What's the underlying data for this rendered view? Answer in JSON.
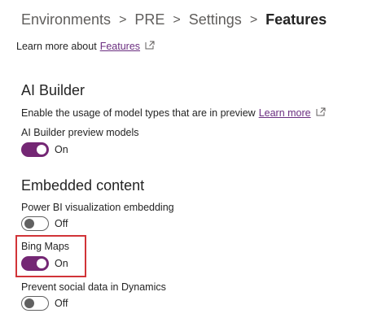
{
  "breadcrumb": {
    "items": [
      "Environments",
      "PRE",
      "Settings"
    ],
    "current": "Features",
    "separator": ">"
  },
  "intro": {
    "text": "Learn more about",
    "link": "Features"
  },
  "ai_builder": {
    "title": "AI Builder",
    "description": "Enable the usage of model types that are in preview",
    "learn_more": "Learn more",
    "setting_label": "AI Builder preview models",
    "toggle_state": "On"
  },
  "embedded": {
    "title": "Embedded content",
    "powerbi_label": "Power BI visualization embedding",
    "powerbi_state": "Off",
    "bing_label": "Bing Maps",
    "bing_state": "On",
    "social_label": "Prevent social data in Dynamics",
    "social_state": "Off"
  },
  "colors": {
    "toggle_on": "#742774",
    "link": "#6b2e80",
    "highlight": "#d13438"
  }
}
